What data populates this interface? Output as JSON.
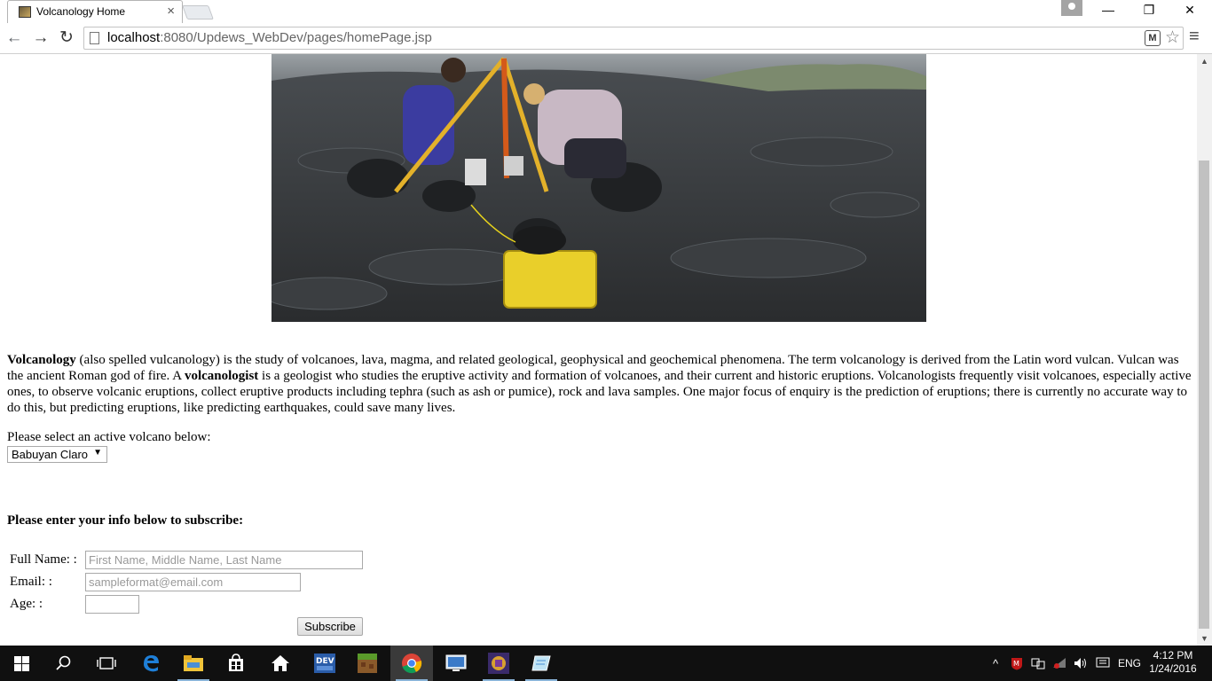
{
  "browser": {
    "tab_title": "Volcanology Home",
    "tab_close": "×",
    "url_host": "localhost",
    "url_path": ":8080/Updews_WebDev/pages/homePage.jsp",
    "window_controls": {
      "minimize": "—",
      "restore": "❐",
      "close": "✕"
    },
    "nav": {
      "back": "←",
      "forward": "→",
      "reload": "↻"
    },
    "star": "☆",
    "menu": "≡",
    "extension_glyph": "M"
  },
  "page": {
    "hero_image": "volcanologists-field-photo",
    "intro": {
      "term1": "Volcanology",
      "text1": " (also spelled vulcanology) is the study of volcanoes, lava, magma, and related geological, geophysical and geochemical phenomena. The term volcanology is derived from the Latin word vulcan. Vulcan was the ancient Roman god of fire. A ",
      "term2": "volcanologist",
      "text2": " is a geologist who studies the eruptive activity and formation of volcanoes, and their current and historic eruptions. Volcanologists frequently visit volcanoes, especially active ones, to observe volcanic eruptions, collect eruptive products including tephra (such as ash or pumice), rock and lava samples. One major focus of enquiry is the prediction of eruptions; there is currently no accurate way to do this, but predicting eruptions, like predicting earthquakes, could save many lives."
    },
    "select_label": "Please select an active volcano below:",
    "volcano_selected": "Babuyan Claro",
    "select_arrow": "▼",
    "subscribe_heading": "Please enter your info below to subscribe:",
    "form": {
      "fullname_label": "Full Name: :",
      "fullname_placeholder": "First Name, Middle Name, Last Name",
      "email_label": "Email: :",
      "email_placeholder": "sampleformat@email.com",
      "age_label": "Age: :",
      "age_value": "",
      "submit_label": "Subscribe"
    }
  },
  "scrollbar": {
    "up": "▲",
    "down": "▼"
  },
  "taskbar": {
    "apps": [
      "start",
      "search",
      "task-view",
      "edge",
      "file-explorer",
      "store",
      "home",
      "dev-app",
      "minecraft",
      "chrome",
      "remote-desktop",
      "game-app",
      "notepad"
    ],
    "tray": {
      "chevron": "^",
      "language": "ENG"
    },
    "time": "4:12 PM",
    "date": "1/24/2016"
  },
  "colors": {
    "taskbar": "#101010",
    "chrome_border": "#c4c4c4"
  }
}
